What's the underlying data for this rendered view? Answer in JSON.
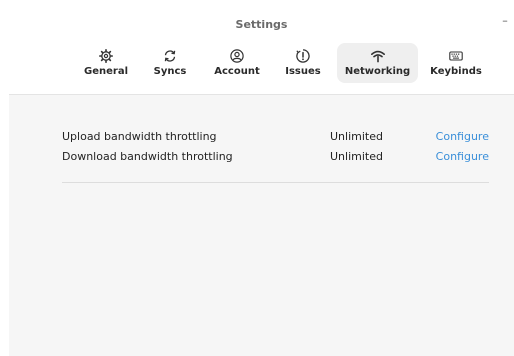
{
  "window": {
    "title": "Settings",
    "minimize_label": "–"
  },
  "tabs": [
    {
      "label": "General",
      "icon": "gear-icon",
      "active": false
    },
    {
      "label": "Syncs",
      "icon": "sync-icon",
      "active": false
    },
    {
      "label": "Account",
      "icon": "account-icon",
      "active": false
    },
    {
      "label": "Issues",
      "icon": "issues-icon",
      "active": false
    },
    {
      "label": "Networking",
      "icon": "wifi-icon",
      "active": true
    },
    {
      "label": "Keybinds",
      "icon": "keyboard-icon",
      "active": false
    }
  ],
  "networking": {
    "rows": [
      {
        "name": "Upload bandwidth throttling",
        "value": "Unlimited",
        "action": "Configure"
      },
      {
        "name": "Download bandwidth throttling",
        "value": "Unlimited",
        "action": "Configure"
      }
    ]
  },
  "colors": {
    "link": "#3a8fd9",
    "active_tab_bg": "#efefef",
    "content_bg": "#f6f6f6"
  }
}
